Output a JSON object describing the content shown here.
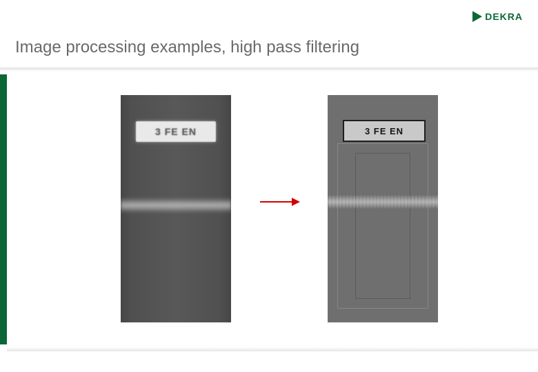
{
  "brand": {
    "name": "DEKRA",
    "accent_color": "#0b6836"
  },
  "slide": {
    "title": "Image processing examples, high pass filtering"
  },
  "figure": {
    "left_label": "3 FE EN",
    "right_label": "3 FE EN",
    "arrow_color": "#d40000"
  }
}
